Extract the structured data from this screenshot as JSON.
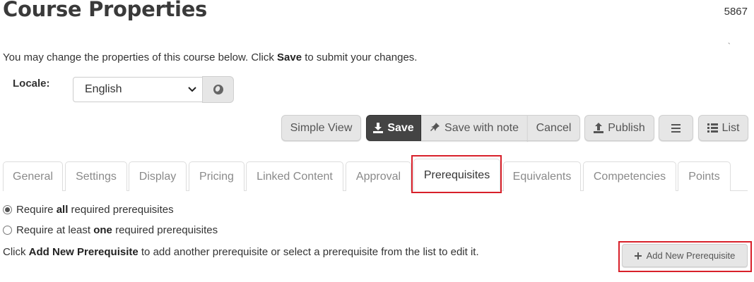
{
  "page": {
    "title": "Course Properties",
    "course_id": "5867",
    "tick_mark": "`",
    "intro_before": "You may change the properties of this course below. Click ",
    "intro_bold": "Save",
    "intro_after": " to submit your changes."
  },
  "locale": {
    "label": "Locale:",
    "selected": "English",
    "select_icon": "chevron-down-icon",
    "globe_icon": "globe-icon"
  },
  "toolbar": {
    "simple_view": "Simple View",
    "save": "Save",
    "save_with_note": "Save with note",
    "cancel": "Cancel",
    "publish": "Publish",
    "list": "List",
    "icons": {
      "save": "download-icon",
      "save_with_note": "pin-icon",
      "publish": "upload-icon",
      "menu": "hamburger-icon",
      "list": "list-icon"
    }
  },
  "tabs": [
    {
      "label": "General"
    },
    {
      "label": "Settings"
    },
    {
      "label": "Display"
    },
    {
      "label": "Pricing"
    },
    {
      "label": "Linked Content"
    },
    {
      "label": "Approval"
    },
    {
      "label": "Prerequisites",
      "active": true
    },
    {
      "label": "Equivalents"
    },
    {
      "label": "Competencies"
    },
    {
      "label": "Points"
    }
  ],
  "prerequisites": {
    "option_all_before": "Require ",
    "option_all_bold": "all",
    "option_all_after": " required prerequisites",
    "option_one_before": "Require at least ",
    "option_one_bold": "one",
    "option_one_after": " required prerequisites",
    "selected_option": "all",
    "help_before": "Click ",
    "help_bold": "Add New Prerequisite",
    "help_after": " to add another prerequisite or select a prerequisite from the list to edit it.",
    "add_button": "Add New Prerequisite",
    "add_icon": "plus-icon"
  },
  "colors": {
    "highlight": "#d8202a",
    "save_button_bg": "#444444",
    "button_bg": "#e6e6e6"
  }
}
